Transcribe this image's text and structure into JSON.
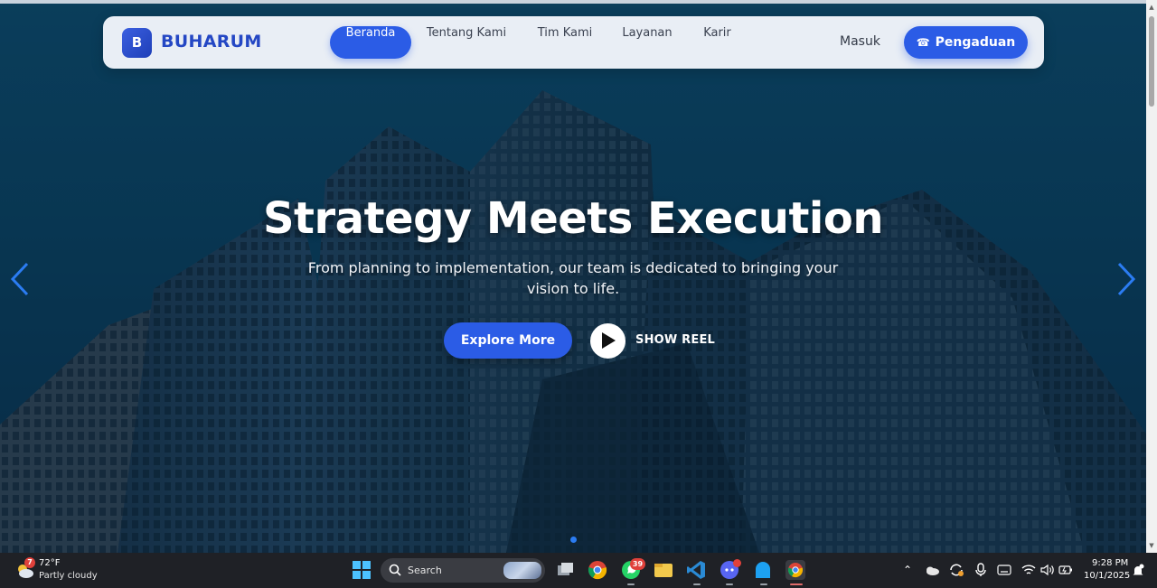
{
  "brand": {
    "logo_letter": "B",
    "name": "BUHARUM"
  },
  "nav": {
    "items": [
      {
        "label": "Beranda",
        "active": true
      },
      {
        "label": "Tentang Kami",
        "active": false
      },
      {
        "label": "Tim Kami",
        "active": false
      },
      {
        "label": "Layanan",
        "active": false
      },
      {
        "label": "Karir",
        "active": false
      }
    ],
    "login": "Masuk",
    "cta": "Pengaduan"
  },
  "hero": {
    "title": "Strategy Meets Execution",
    "subtitle": "From planning to implementation, our team is dedicated to bringing your vision to life.",
    "primary_button": "Explore More",
    "secondary_button": "SHOW REEL",
    "slide_index": 1
  },
  "colors": {
    "accent": "#2b5ce6",
    "brand_text": "#2447c4",
    "taskbar": "#1f2126"
  },
  "taskbar": {
    "weather": {
      "temp": "72°F",
      "condition": "Partly cloudy",
      "badge": "7"
    },
    "search_label": "Search",
    "apps": [
      {
        "name": "windows-start"
      },
      {
        "name": "task-view"
      },
      {
        "name": "chrome"
      },
      {
        "name": "whatsapp",
        "badge": "39"
      },
      {
        "name": "file-explorer"
      },
      {
        "name": "vscode"
      },
      {
        "name": "discord"
      },
      {
        "name": "app"
      },
      {
        "name": "chrome-profile"
      }
    ],
    "clock": {
      "time": "9:28 PM",
      "date": "10/1/2025"
    }
  }
}
